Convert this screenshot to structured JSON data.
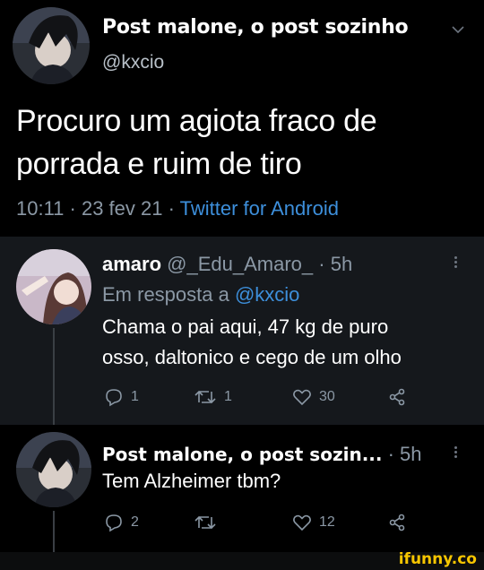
{
  "main_tweet": {
    "author_name": "Post malone, o post sozinho",
    "handle": "@kxcio",
    "text_line1": "Procuro um agiota fraco de",
    "text_line2": "porrada e ruim de tiro",
    "timestamp": "10:11 · 23 fev 21 · ",
    "source": "Twitter for Android"
  },
  "reply1": {
    "author_name": "amaro",
    "meta": "@_Edu_Amaro_ · 5h",
    "reply_prefix": "Em resposta a ",
    "reply_handle": "@kxcio",
    "text_line1": "Chama o pai aqui, 47 kg de puro",
    "text_line2": "osso, daltonico e cego de um olho",
    "replies": "1",
    "retweets": "1",
    "likes": "30"
  },
  "reply2": {
    "author_name": "Post malone, o post sozin...",
    "meta": "· 5h",
    "text": "Tem Alzheimer tbm?",
    "replies": "2",
    "retweets": "",
    "likes": "12"
  },
  "watermark": "ifunny.co",
  "colors": {
    "background": "#000000",
    "reply1_background": "#15181c",
    "link": "#3d8fdb",
    "watermark": "#f7c600"
  }
}
